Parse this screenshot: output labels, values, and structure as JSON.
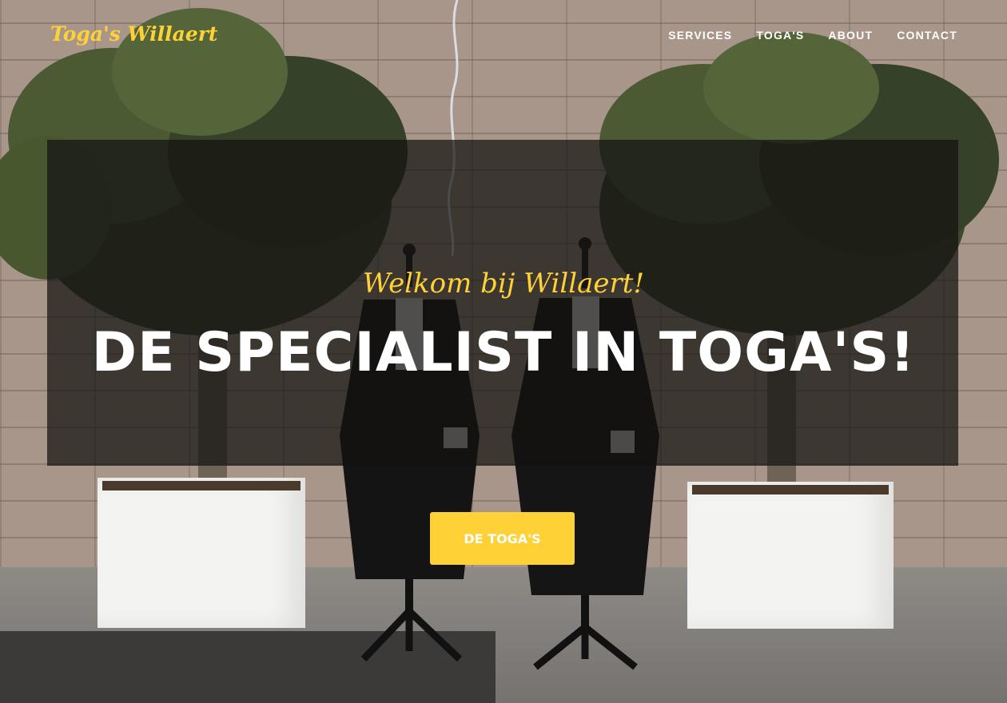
{
  "brand": {
    "name": "Toga's Willaert"
  },
  "nav": {
    "items": [
      {
        "label": "SERVICES"
      },
      {
        "label": "TOGA'S"
      },
      {
        "label": "ABOUT"
      },
      {
        "label": "CONTACT"
      }
    ]
  },
  "hero": {
    "lead_in": "Welkom bij Willaert!",
    "heading": "DE SPECIALIST IN TOGA'S!",
    "cta_label": "DE TOGA'S"
  },
  "colors": {
    "accent": "#fed136",
    "text_light": "#ffffff",
    "overlay": "rgba(20,18,17,0.72)"
  }
}
